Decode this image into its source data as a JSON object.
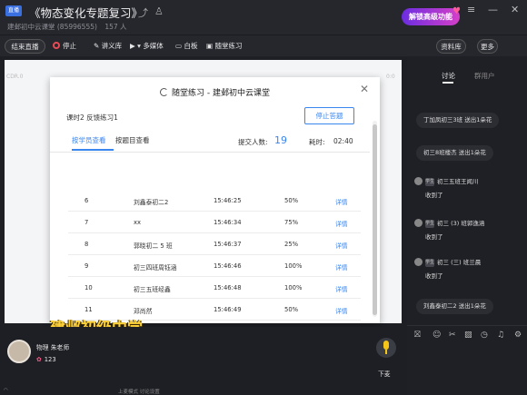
{
  "titlebar": {
    "logo_text": "直播",
    "title": "《物态变化专题复习》",
    "subtitle": "建邺初中云课堂 (85996555)",
    "viewers": "157 人",
    "promo": "解锁高级功能"
  },
  "toolbar": {
    "end_live": "结束直播",
    "stop": "停止",
    "lecture": "讲义库",
    "media": "多媒体",
    "whiteboard": "白板",
    "quiz": "随堂练习",
    "resources": "资料库",
    "more": "更多"
  },
  "stage": {
    "left_tag": "CDR.0",
    "right_tag": "0:0"
  },
  "dialog": {
    "title": "随堂练习 - 建邺初中云课堂",
    "lesson": "课时2 反馈练习1",
    "stop_button": "停止答题",
    "tabs": [
      "按学员查看",
      "按题目查看"
    ],
    "submit_label": "提交人数:",
    "submit_count": "19",
    "time_label": "耗时:",
    "time_value": "02:40",
    "rows": [
      {
        "no": "6",
        "name": "刘鑫泰初二2",
        "time": "15:46:25",
        "score": "50%",
        "action": "详情"
      },
      {
        "no": "7",
        "name": "xx",
        "time": "15:46:34",
        "score": "75%",
        "action": "详情"
      },
      {
        "no": "8",
        "name": "郭晓初二 5 班",
        "time": "15:46:37",
        "score": "25%",
        "action": "详情"
      },
      {
        "no": "9",
        "name": "初三四班周钰涵",
        "time": "15:46:46",
        "score": "100%",
        "action": "详情"
      },
      {
        "no": "10",
        "name": "初三五班经鑫",
        "time": "15:46:48",
        "score": "100%",
        "action": "详情"
      },
      {
        "no": "11",
        "name": "邓尚然",
        "time": "15:46:49",
        "score": "50%",
        "action": "详情"
      }
    ]
  },
  "watermark": "建邺初级中学",
  "teacher": {
    "name": "物理 朱老师",
    "flowers": "123"
  },
  "mic": {
    "label": "下麦"
  },
  "bottom_bar": {
    "text": "上麦模式   讨论设置"
  },
  "right_panel": {
    "tabs": [
      "讨论",
      "群用户"
    ],
    "messages": [
      {
        "type": "pill",
        "text": "丁加凤初三3班 送出1朵花"
      },
      {
        "type": "pill",
        "text": "初三8班楼杰 送出1朵花"
      },
      {
        "type": "user",
        "name": "初三五班王闻川",
        "text": "收到了"
      },
      {
        "type": "user",
        "name": "初三 (3) 班郭逸涵",
        "text": "收到了"
      },
      {
        "type": "user",
        "name": "初三 (三) 班兰晨",
        "text": "收到了"
      },
      {
        "type": "pill",
        "text": "刘鑫泰初二2 送出1朵花"
      }
    ],
    "badge_text": "学生"
  }
}
